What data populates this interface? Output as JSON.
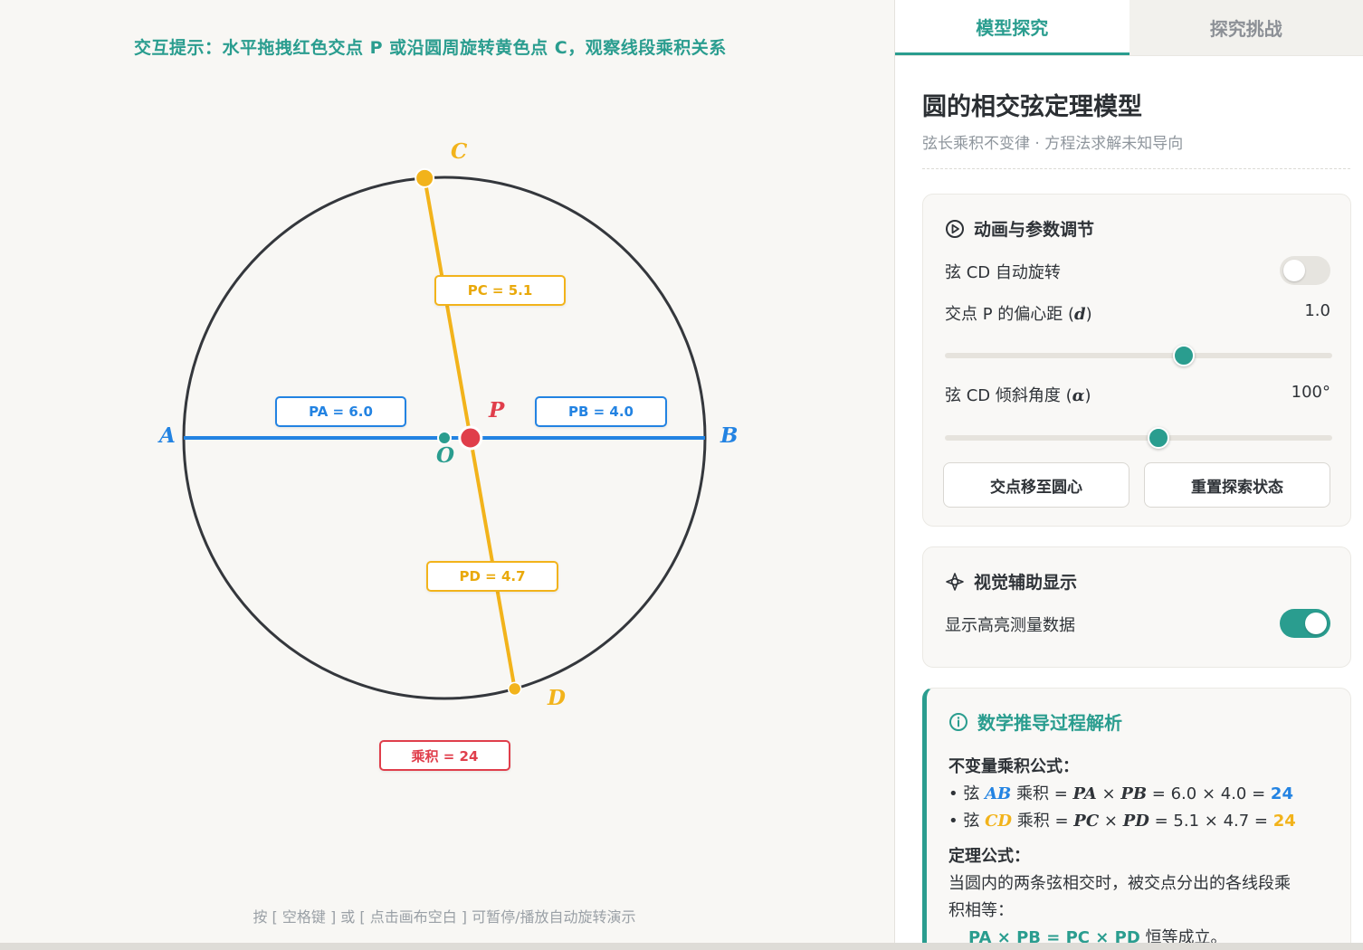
{
  "hint_top": "交互提示：水平拖拽红色交点 P 或沿圆周旋转黄色点 C，观察线段乘积关系",
  "hint_bottom": "按 [ 空格键 ] 或 [ 点击画布空白 ] 可暂停/播放自动旋转演示",
  "colors": {
    "teal": "#2a9d8f",
    "blue": "#2383e2",
    "gold": "#f2b31b",
    "red": "#e03e4b",
    "circle": "#34373c"
  },
  "geometry": {
    "radius": 10,
    "d": 1.0,
    "alpha_deg": 100
  },
  "points": {
    "A": "A",
    "B": "B",
    "C": "C",
    "D": "D",
    "P": "P",
    "O": "O"
  },
  "measures": {
    "pa": "PA = 6.0",
    "pb": "PB = 4.0",
    "pc": "PC = 5.1",
    "pd": "PD = 4.7",
    "product": "乘积 = 24"
  },
  "tabs": [
    {
      "label": "模型探究",
      "active": true
    },
    {
      "label": "探究挑战",
      "active": false
    }
  ],
  "panel": {
    "title": "圆的相交弦定理模型",
    "subtitle": "弦长乘积不变律 · 方程法求解未知导向"
  },
  "controls": {
    "heading": "动画与参数调节",
    "auto_rotate_label": "弦 CD 自动旋转",
    "auto_rotate_on": false,
    "offset_label_prefix": "交点 P 的偏心距 (",
    "offset_var": "d",
    "offset_label_suffix": ")",
    "offset_value": "1.0",
    "offset_fraction": 0.617,
    "angle_label_prefix": "弦 CD 倾斜角度 (",
    "angle_var": "α",
    "angle_label_suffix": ")",
    "angle_value": "100°",
    "angle_fraction": 0.552,
    "btn_center": "交点移至圆心",
    "btn_reset": "重置探索状态"
  },
  "visual": {
    "heading": "视觉辅助显示",
    "highlight_label": "显示高亮测量数据",
    "highlight_on": true
  },
  "derivation": {
    "heading": "数学推导过程解析",
    "invariant_title": "不变量乘积公式：",
    "bullet": "• 弦",
    "ab_var": "AB",
    "cd_var": "CD",
    "product_word": "乘积 =",
    "pa_var": "PA",
    "pb_var": "PB",
    "pc_var": "PC",
    "pd_var": "PD",
    "times": "×",
    "ab_numeric": "= 6.0 × 4.0 =",
    "cd_numeric": "= 5.1 × 4.7 =",
    "ab_result": "24",
    "cd_result": "24",
    "theorem_title": "定理公式：",
    "theorem_line1": "当圆内的两条弦相交时，被交点分出的各线段乘",
    "theorem_line2": "积相等：",
    "formula": "PA × PB = PC × PD",
    "formula_suffix": "恒等成立。"
  }
}
